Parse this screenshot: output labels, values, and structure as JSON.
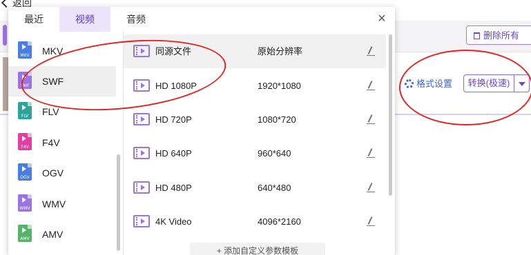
{
  "background": {
    "back_label": "返回",
    "delete_all_label": "删除所有",
    "format_settings_label": "格式设置",
    "convert_label": "转换(极速)"
  },
  "popup": {
    "tabs": [
      {
        "label": "最近",
        "active": false
      },
      {
        "label": "视频",
        "active": true
      },
      {
        "label": "音频",
        "active": false
      }
    ],
    "close_glyph": "×",
    "formats": [
      {
        "label": "MKV",
        "tag": "MKV",
        "color": "#4a7de0",
        "selected": false
      },
      {
        "label": "SWF",
        "tag": "SWF",
        "color": "#9a74e2",
        "selected": true
      },
      {
        "label": "FLV",
        "tag": "FLV",
        "color": "#2fa39a",
        "selected": false
      },
      {
        "label": "F4V",
        "tag": "F4V",
        "color": "#e23ea3",
        "selected": false
      },
      {
        "label": "OGV",
        "tag": "OGV",
        "color": "#4a7de0",
        "selected": false
      },
      {
        "label": "WMV",
        "tag": "WMV",
        "color": "#9a74e2",
        "selected": false
      },
      {
        "label": "AMV",
        "tag": "AMV",
        "color": "#57b36a",
        "selected": false
      }
    ],
    "resolutions": [
      {
        "name": "同源文件",
        "size": "原始分辨率",
        "selected": true
      },
      {
        "name": "HD 1080P",
        "size": "1920*1080",
        "selected": false
      },
      {
        "name": "HD 720P",
        "size": "1080*720",
        "selected": false
      },
      {
        "name": "HD 640P",
        "size": "960*640",
        "selected": false
      },
      {
        "name": "HD 480P",
        "size": "640*480",
        "selected": false
      },
      {
        "name": "4K Video",
        "size": "4096*2160",
        "selected": false
      }
    ],
    "custom_button_label": "+ 添加自定义参数模板"
  },
  "colors": {
    "accent": "#6a45d6",
    "annotation_red": "#e52424",
    "link_blue": "#3d62d8"
  }
}
